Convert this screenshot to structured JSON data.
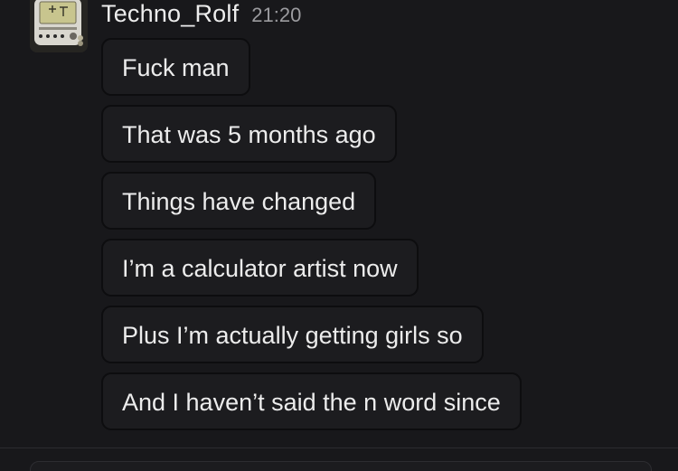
{
  "message_group": {
    "author": "Techno_Rolf",
    "timestamp": "21:20",
    "avatar_icon": "calculator-avatar",
    "messages": [
      "Fuck man",
      "That was 5 months ago",
      "Things have changed",
      "I’m a calculator artist now",
      "Plus I’m actually getting girls so",
      "And I haven’t said the n word since"
    ]
  },
  "composer": {
    "placeholder": ""
  }
}
